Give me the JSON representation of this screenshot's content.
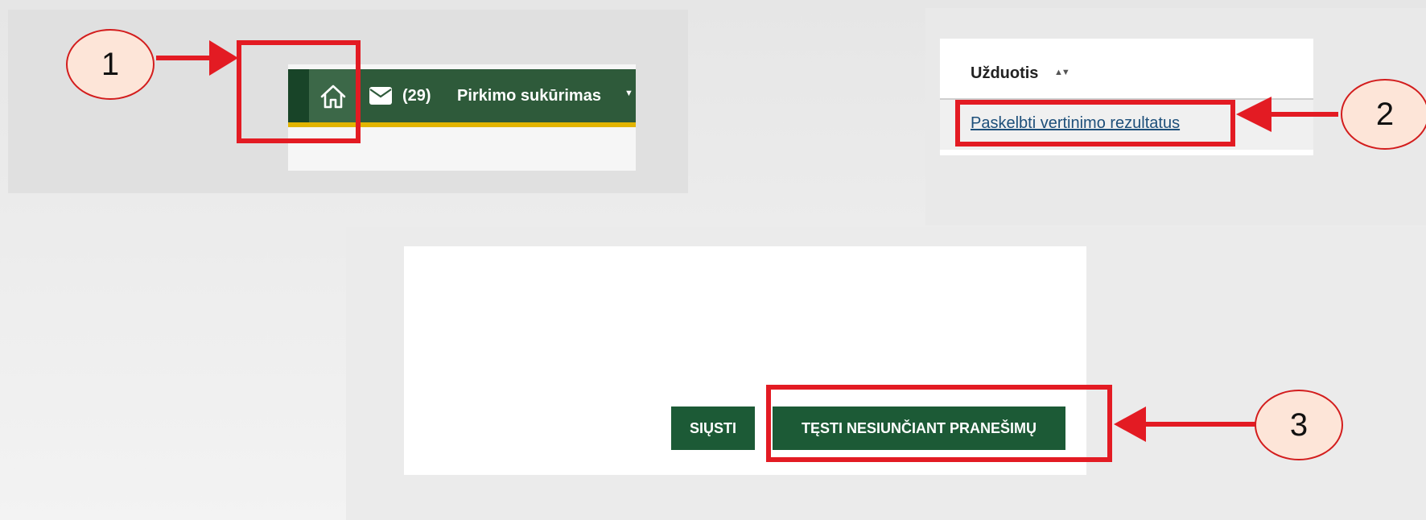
{
  "nav": {
    "message_count": "(29)",
    "menu_label": "Pirkimo sukūrimas"
  },
  "table": {
    "column_header": "Užduotis",
    "task_link": "Paskelbti vertinimo rezultatus"
  },
  "dialog": {
    "send_button": "SIŲSTI",
    "continue_button": "TĘSTI NESIUNČIANT PRANEŠIMŲ"
  },
  "callouts": {
    "step1": "1",
    "step2": "2",
    "step3": "3"
  },
  "colors": {
    "nav_green": "#2e5a3a",
    "nav_stripe": "#e2b400",
    "button_green": "#1c5a36",
    "annotation_red": "#e31b23",
    "callout_fill": "#fde5d8"
  },
  "icons": [
    "home-icon",
    "mail-icon",
    "sort-icon",
    "caret-down-icon"
  ]
}
